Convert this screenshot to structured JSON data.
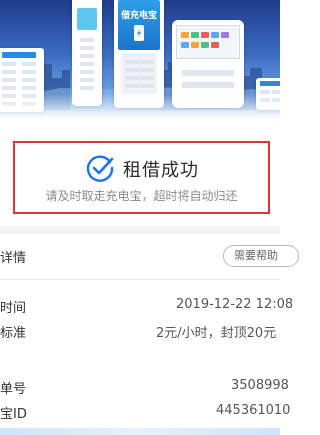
{
  "banner": {
    "brand_text": "借充电宝"
  },
  "status": {
    "icon": "check-circle-icon",
    "title": "租借成功",
    "subtitle": "请及时取走充电宝，超时将自动归还",
    "highlight_color": "#d9383a",
    "accent_color": "#1a73e8"
  },
  "details": {
    "title": "详情",
    "help_label": "需要帮助",
    "rows": [
      {
        "label": "时间",
        "value": "2019-12-22 12:08"
      },
      {
        "label": "标准",
        "value": "2元/小时，封顶20元"
      },
      {
        "label": "单号",
        "value": "3508998"
      },
      {
        "label": "宝ID",
        "value": "445361010"
      }
    ]
  }
}
